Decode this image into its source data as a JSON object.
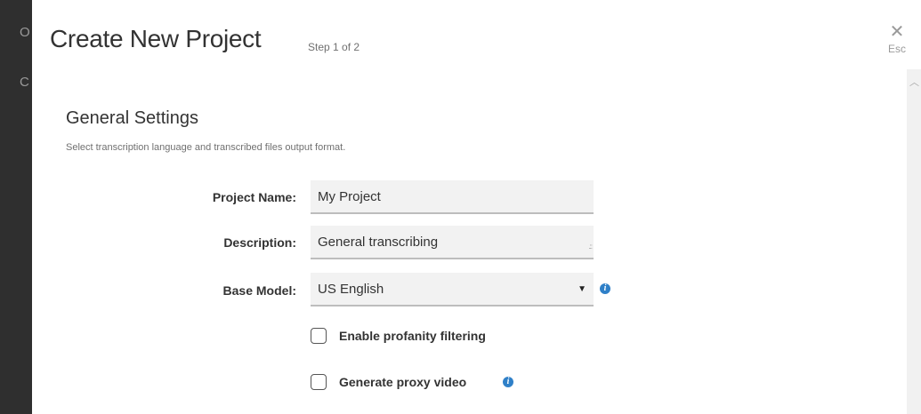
{
  "background_strip": {
    "letters": [
      "O",
      "C"
    ]
  },
  "modal": {
    "title": "Create New Project",
    "step": "Step 1 of 2",
    "close": {
      "icon": "close-icon",
      "label": "Esc"
    }
  },
  "section": {
    "title": "General Settings",
    "description": "Select transcription language and transcribed files output format."
  },
  "form": {
    "project_name": {
      "label": "Project Name:",
      "value": "My Project"
    },
    "description": {
      "label": "Description:",
      "value": "General transcribing"
    },
    "base_model": {
      "label": "Base Model:",
      "selected": "US English",
      "info_icon": "info-icon"
    },
    "profanity": {
      "label": "Enable profanity filtering",
      "checked": false
    },
    "proxy_video": {
      "label": "Generate proxy video",
      "checked": false,
      "info_icon": "info-icon"
    }
  },
  "colors": {
    "accent": "#2f80c8",
    "field_bg": "#f2f2f2",
    "sidebar_bg": "#2f2f2f"
  }
}
